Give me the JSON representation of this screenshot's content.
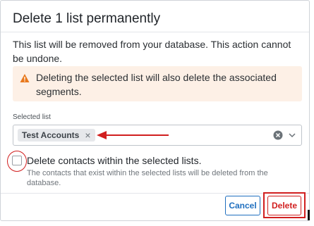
{
  "dialog": {
    "title": "Delete 1 list permanently",
    "description": "This list will be removed from your database. This action cannot be undone.",
    "warning": {
      "icon": "warning-triangle-icon",
      "text": "Deleting the selected list will also delete the associated segments."
    },
    "selected_list": {
      "label": "Selected list",
      "tags": [
        "Test Accounts"
      ]
    },
    "checkbox": {
      "checked": false,
      "label": "Delete contacts within the selected lists.",
      "help": "The contacts that exist within the selected lists will be deleted from the database."
    },
    "buttons": {
      "cancel": "Cancel",
      "delete": "Delete"
    }
  },
  "colors": {
    "warning_bg": "#fdf0e6",
    "warning_icon": "#e8781c",
    "annotation_red": "#d11f1f",
    "cancel_blue": "#1f6fbf"
  }
}
